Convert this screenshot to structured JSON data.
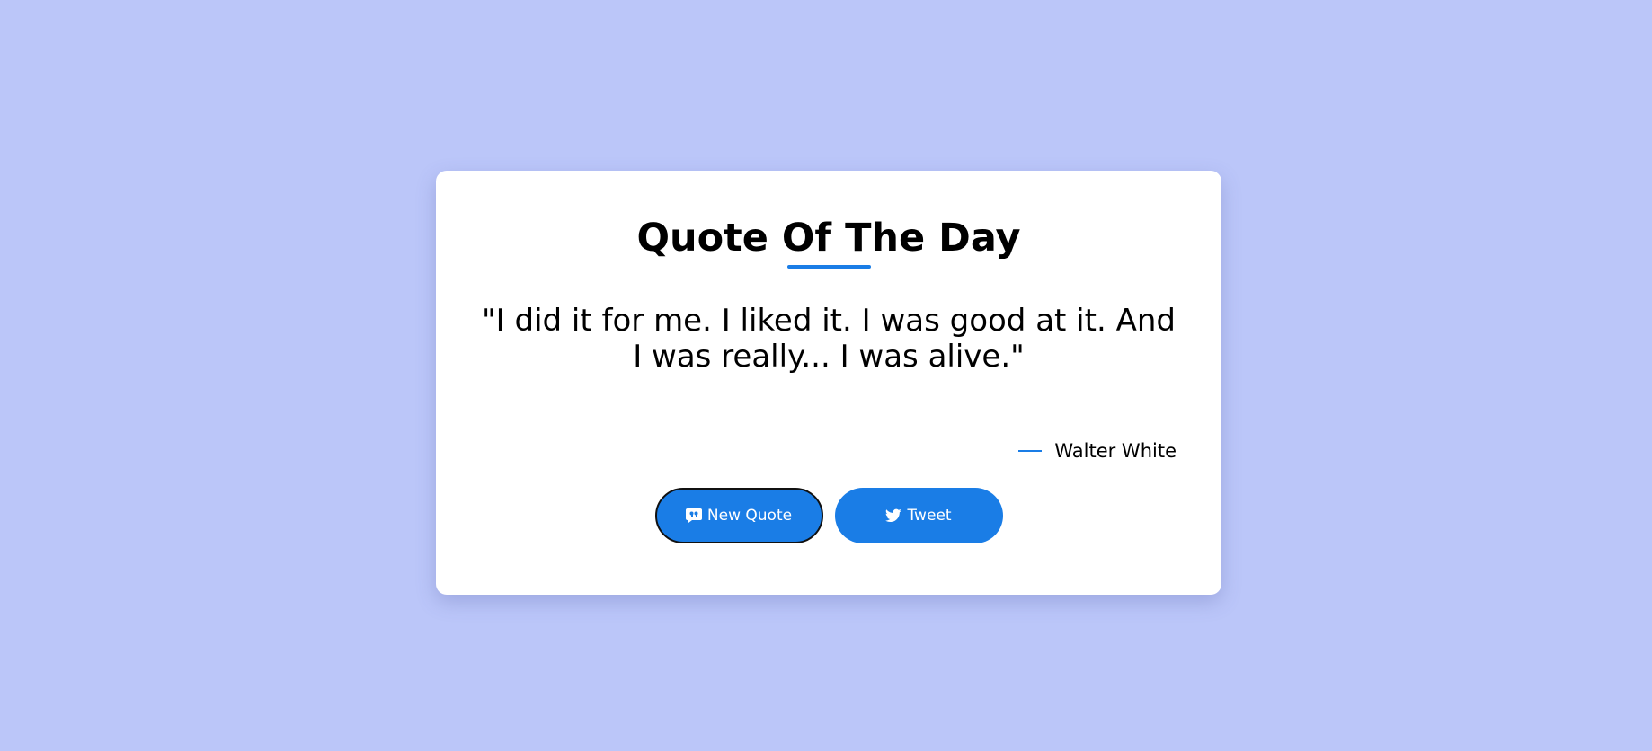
{
  "card": {
    "title": "Quote Of The Day",
    "quote": "\"I did it for me. I liked it. I was good at it. And I was really... I was alive.\"",
    "author": "Walter White"
  },
  "buttons": {
    "new_quote_label": "New Quote",
    "new_quote_icon": "quote-bubble-icon",
    "tweet_label": "Tweet",
    "tweet_icon": "twitter-icon"
  },
  "colors": {
    "background": "#bbc6f9",
    "card": "#ffffff",
    "accent": "#1a7de6",
    "text": "#000000"
  }
}
